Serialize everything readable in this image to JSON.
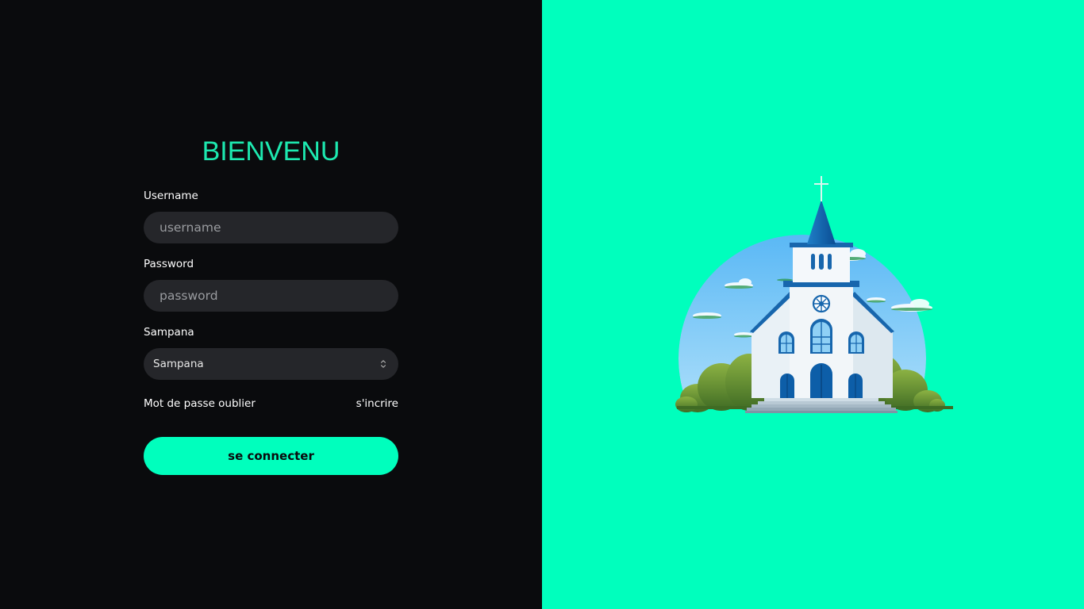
{
  "login": {
    "title": "BIENVENU",
    "username": {
      "label": "Username",
      "placeholder": "username",
      "value": ""
    },
    "password": {
      "label": "Password",
      "placeholder": "password",
      "value": ""
    },
    "sampana": {
      "label": "Sampana",
      "selected": "Sampana"
    },
    "forgot_password_link": "Mot de passe oublier",
    "signup_link": "s'incrire",
    "submit_label": "se connecter"
  },
  "colors": {
    "accent": "#00ffbd",
    "left_background": "#0a0b0d",
    "input_background": "#25262a",
    "title": "#1de9b0"
  },
  "illustration": {
    "icon": "church-illustration"
  }
}
